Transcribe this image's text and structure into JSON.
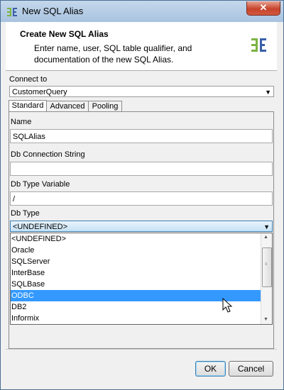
{
  "window": {
    "title": "New SQL Alias",
    "close_label": "✕"
  },
  "header": {
    "title": "Create New SQL Alias",
    "description": "Enter name, user, SQL table qualifier, and documentation of the new SQL Alias."
  },
  "connect": {
    "label": "Connect to",
    "value": "CustomerQuery"
  },
  "tabs": [
    {
      "label": "Standard",
      "selected": true
    },
    {
      "label": "Advanced",
      "selected": false
    },
    {
      "label": "Pooling",
      "selected": false
    }
  ],
  "form": {
    "name_label": "Name",
    "name_value": "SQLAlias",
    "conn_label": "Db Connection String",
    "conn_value": "",
    "typevar_label": "Db Type Variable",
    "typevar_value": "/",
    "dbtype_label": "Db Type",
    "dbtype_value": "<UNDEFINED>"
  },
  "dropdown": {
    "items": [
      "<UNDEFINED>",
      "Oracle",
      "SQLServer",
      "InterBase",
      "SQLBase",
      "ODBC",
      "DB2",
      "Informix"
    ],
    "highlighted": "ODBC"
  },
  "buttons": {
    "ok": "OK",
    "cancel": "Cancel"
  },
  "colors": {
    "selection": "#3399ff",
    "titlebar": "#b8d0ea"
  }
}
